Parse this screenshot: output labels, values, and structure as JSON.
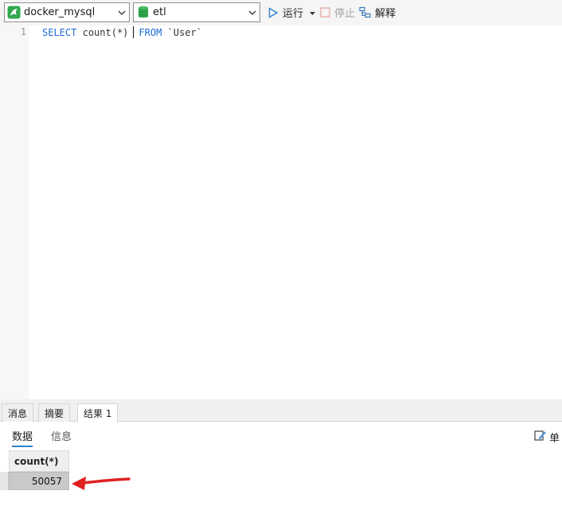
{
  "toolbar": {
    "connection": {
      "value": "docker_mysql",
      "icon": "mysql-dolphin-icon"
    },
    "database": {
      "value": "etl",
      "icon": "database-cylinder-icon"
    },
    "run_label": "运行",
    "stop_label": "停止",
    "explain_label": "解释"
  },
  "editor": {
    "line_number": "1",
    "tokens": {
      "select_kw": "SELECT",
      "func": "count(*)",
      "from_kw": "FROM",
      "table": "`User`"
    }
  },
  "result_tabs": [
    {
      "label": "消息"
    },
    {
      "label": "摘要"
    },
    {
      "label": "结果 1",
      "active": true
    }
  ],
  "sub_tabs": [
    {
      "label": "数据",
      "active": true
    },
    {
      "label": "信息"
    }
  ],
  "right_button_label": "单",
  "grid": {
    "columns": [
      "count(*)"
    ],
    "rows": [
      [
        "50057"
      ]
    ]
  },
  "colors": {
    "accent": "#2f80d1",
    "keyword": "#1e6bd6",
    "annotation_arrow": "#e02020",
    "db_icon": "#2fa84f"
  }
}
